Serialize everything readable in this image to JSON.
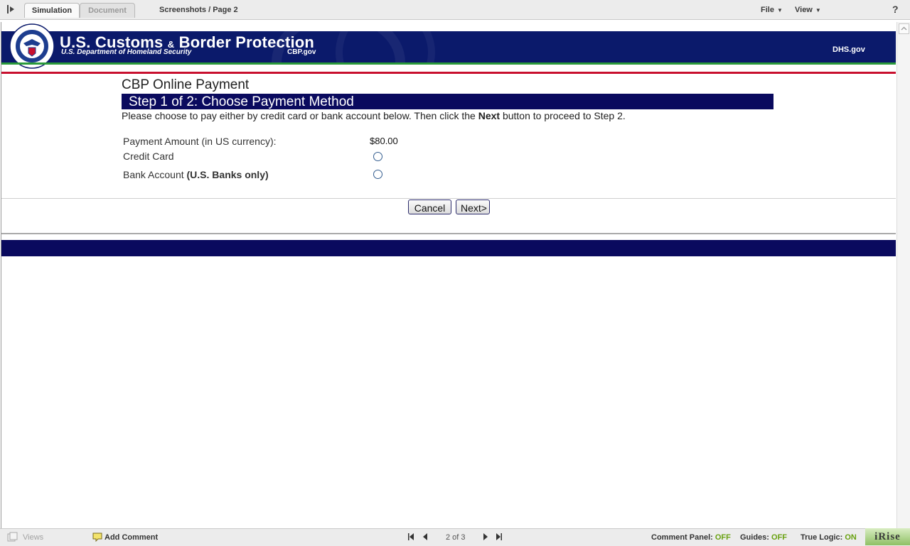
{
  "app": {
    "tabs": [
      {
        "label": "Simulation",
        "active": true
      },
      {
        "label": "Document",
        "active": false
      }
    ],
    "breadcrumb": "Screenshots / Page 2",
    "menus": {
      "file": "File",
      "view": "View"
    },
    "help": "?"
  },
  "banner": {
    "title": "U.S. Customs",
    "amp": "&",
    "title2": "Border Protection",
    "subtitle": "U.S. Department of Homeland Security",
    "cbpgov": "CBP.gov",
    "dhs_link": "DHS.gov",
    "colors": {
      "navy": "#0b1a6b",
      "green": "#2a9a3a",
      "red": "#c8102e"
    }
  },
  "form": {
    "title": "CBP Online Payment",
    "step_title": "Step 1 of 2: Choose Payment Method",
    "instructions_pre": "Please choose to pay either by credit card or bank account below. Then click the ",
    "instructions_bold": "Next",
    "instructions_post": " button to proceed to Step 2.",
    "amount_label": "Payment Amount (in US currency):",
    "amount_value": "$80.00",
    "options": [
      {
        "label": "Credit Card",
        "note": ""
      },
      {
        "label": "Bank Account ",
        "note": "(U.S. Banks only)"
      }
    ],
    "cancel_label": "Cancel",
    "next_label": "Next>"
  },
  "statusbar": {
    "views": "Views",
    "add_comment": "Add Comment",
    "page_indicator": "2 of 3",
    "comment_panel_label": "Comment Panel:",
    "comment_panel_value": "OFF",
    "guides_label": "Guides:",
    "guides_value": "OFF",
    "true_logic_label": "True Logic:",
    "true_logic_value": "ON",
    "brand": "iRise"
  }
}
